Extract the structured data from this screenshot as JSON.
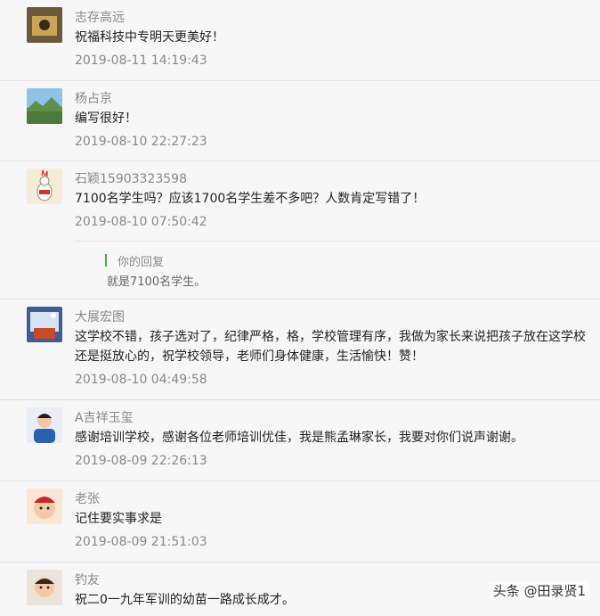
{
  "comments": [
    {
      "name": "志存高远",
      "text": "祝福科技中专明天更美好！",
      "time": "2019-08-11 14:19:43"
    },
    {
      "name": "杨占京",
      "text": "编写很好！",
      "time": "2019-08-10 22:27:23"
    },
    {
      "name": "石颖15903323598",
      "text": "7100名学生吗？应该1700名学生差不多吧？人数肯定写错了！",
      "time": "2019-08-10 07:50:42",
      "reply": {
        "label": "你的回复",
        "text": "就是7100名学生。"
      }
    },
    {
      "name": "大展宏图",
      "text": "这学校不错，孩子选对了，纪律严格，格，学校管理有序，我做为家长来说把孩子放在这学校还是挺放心的，祝学校领导，老师们身体健康，生活愉快！赞！",
      "time": "2019-08-10 04:49:58"
    },
    {
      "name": "A吉祥玉玺",
      "text": "感谢培训学校，感谢各位老师培训优佳，我是熊孟琳家长，我要对你们说声谢谢。",
      "time": "2019-08-09 22:26:13"
    },
    {
      "name": "老张",
      "text": "记住要实事求是",
      "time": "2019-08-09 21:51:03"
    },
    {
      "name": "钓友",
      "text": "祝二0一九年军训的幼苗一路成长成才。",
      "time": ""
    }
  ],
  "watermark": "头条 @田录贤1"
}
